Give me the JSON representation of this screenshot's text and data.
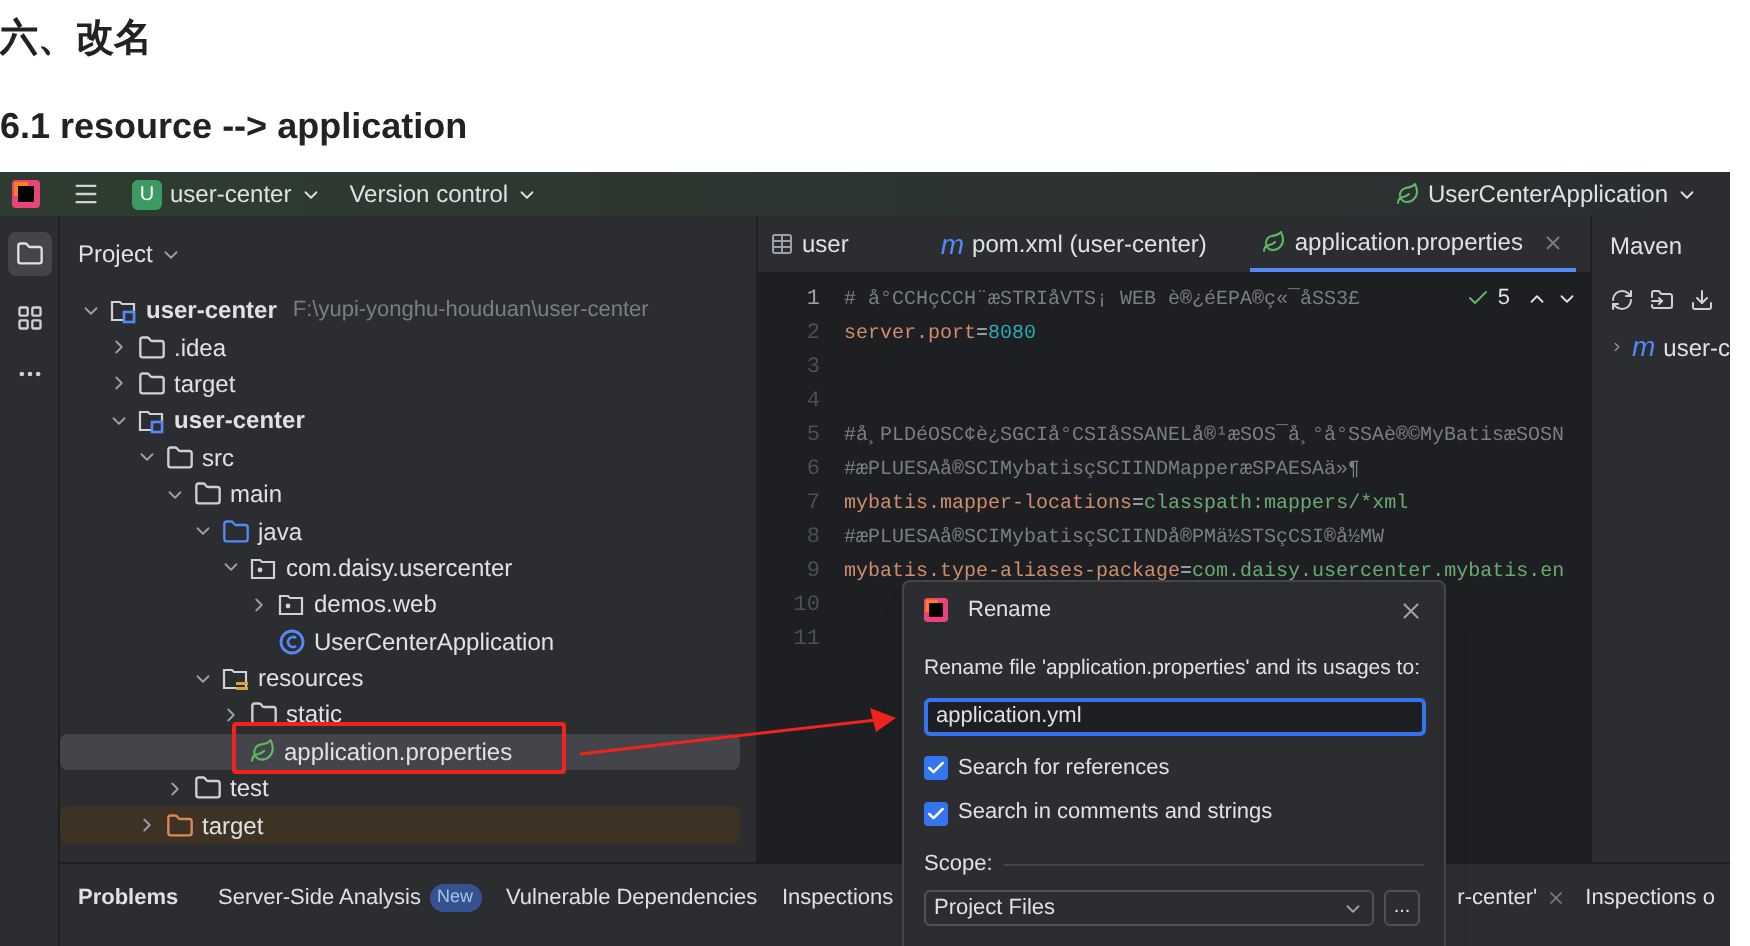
{
  "article": {
    "heading": "六、改名",
    "subheading": "6.1 resource --> application"
  },
  "toolbar": {
    "project_badge": "U",
    "project": "user-center",
    "vcs": "Version control",
    "run_config": "UserCenterApplication"
  },
  "project_panel": {
    "title": "Project",
    "tree": [
      {
        "label": "user-center",
        "kind": "module",
        "path": "F:\\yupi-yonghu-houduan\\user-center",
        "expanded": true,
        "selected": false,
        "children": [
          {
            "label": ".idea",
            "kind": "folder",
            "expanded": false,
            "selected": false
          },
          {
            "label": "target",
            "kind": "folder",
            "expanded": false,
            "selected": false
          },
          {
            "label": "user-center",
            "kind": "module",
            "expanded": true,
            "selected": false,
            "children": [
              {
                "label": "src",
                "kind": "folder",
                "expanded": true,
                "selected": false,
                "children": [
                  {
                    "label": "main",
                    "kind": "folder",
                    "expanded": true,
                    "selected": false,
                    "children": [
                      {
                        "label": "java",
                        "kind": "source",
                        "expanded": true,
                        "selected": false,
                        "children": [
                          {
                            "label": "com.daisy.usercenter",
                            "kind": "package",
                            "expanded": true,
                            "selected": false,
                            "children": [
                              {
                                "label": "demos.web",
                                "kind": "package",
                                "expanded": false,
                                "selected": false
                              },
                              {
                                "label": "UserCenterApplication",
                                "kind": "class",
                                "selected": false
                              }
                            ]
                          }
                        ]
                      },
                      {
                        "label": "resources",
                        "kind": "resources",
                        "expanded": true,
                        "selected": false,
                        "children": [
                          {
                            "label": "static",
                            "kind": "folder",
                            "expanded": false,
                            "selected": false
                          },
                          {
                            "label": "application.properties",
                            "kind": "spring",
                            "selected": true
                          }
                        ]
                      }
                    ]
                  },
                  {
                    "label": "test",
                    "kind": "folder",
                    "expanded": false,
                    "selected": false
                  }
                ]
              },
              {
                "label": "target",
                "kind": "excluded",
                "expanded": false,
                "selected": false
              }
            ]
          }
        ]
      }
    ]
  },
  "editor": {
    "tabs": [
      {
        "label": "user",
        "kind": "table",
        "selected": false
      },
      {
        "label": "pom.xml (user-center)",
        "kind": "maven",
        "icon_text": "m",
        "selected": false
      },
      {
        "label": "application.properties",
        "kind": "spring",
        "selected": true
      }
    ],
    "inspection_count": "5",
    "lines": [
      {
        "number": "1",
        "segments": [
          {
            "kind": "comment",
            "text": "# å°CCHçCCH¨æSTRIåVTS¡ WEB è®¿éEPA®ç«¯åSS3£"
          }
        ]
      },
      {
        "number": "2",
        "segments": [
          {
            "kind": "key",
            "text": "server.port"
          },
          {
            "kind": "op",
            "text": "="
          },
          {
            "kind": "number",
            "text": "8080"
          }
        ]
      },
      {
        "number": "3"
      },
      {
        "number": "4"
      },
      {
        "number": "5",
        "segments": [
          {
            "kind": "comment",
            "text": "#å¸PLDéOSC¢è¿SGCIå°CSIåSSANELå®¹æSOS¯å¸°å°SSAè®©MyBatisæSOSN"
          }
        ]
      },
      {
        "number": "6",
        "segments": [
          {
            "kind": "comment",
            "text": "#æPLUESAå®SCIMybatisçSCIINDMapperæSPAESAä»¶"
          }
        ]
      },
      {
        "number": "7",
        "segments": [
          {
            "kind": "key",
            "text": "mybatis.mapper-locations"
          },
          {
            "kind": "op",
            "text": "="
          },
          {
            "kind": "string",
            "text": "classpath:mappers/*xml"
          }
        ]
      },
      {
        "number": "8",
        "segments": [
          {
            "kind": "comment",
            "text": "#æPLUESAå®SCIMybatisçSCIINDå®PMä½STSçCSI®å½MW"
          }
        ]
      },
      {
        "number": "9",
        "segments": [
          {
            "kind": "key",
            "text": "mybatis.type-aliases-package"
          },
          {
            "kind": "op",
            "text": "="
          },
          {
            "kind": "string",
            "text": "com.daisy.usercenter.mybatis.en"
          }
        ]
      },
      {
        "number": "10"
      },
      {
        "number": "11"
      }
    ]
  },
  "maven": {
    "title": "Maven",
    "tree_item": "user-c",
    "icon_text": "m"
  },
  "bottom_tabs": [
    {
      "label": "Problems",
      "selected": false
    },
    {
      "label": "Server-Side Analysis",
      "badge": "New",
      "selected": false
    },
    {
      "label": "Vulnerable Dependencies",
      "selected": false
    },
    {
      "label": "Inspections",
      "selected": false
    },
    {
      "label": "r-center'",
      "closable": true,
      "selected": false
    },
    {
      "label": "Inspections o",
      "selected": false
    }
  ],
  "dialog": {
    "title": "Rename",
    "prompt": "Rename file 'application.properties' and its usages to:",
    "value": "application.yml",
    "options": [
      {
        "label": "Search for references",
        "checked": true
      },
      {
        "label": "Search in comments and strings",
        "checked": true
      }
    ],
    "scope_label": "Scope:",
    "scope": "Project Files",
    "more": "..."
  }
}
